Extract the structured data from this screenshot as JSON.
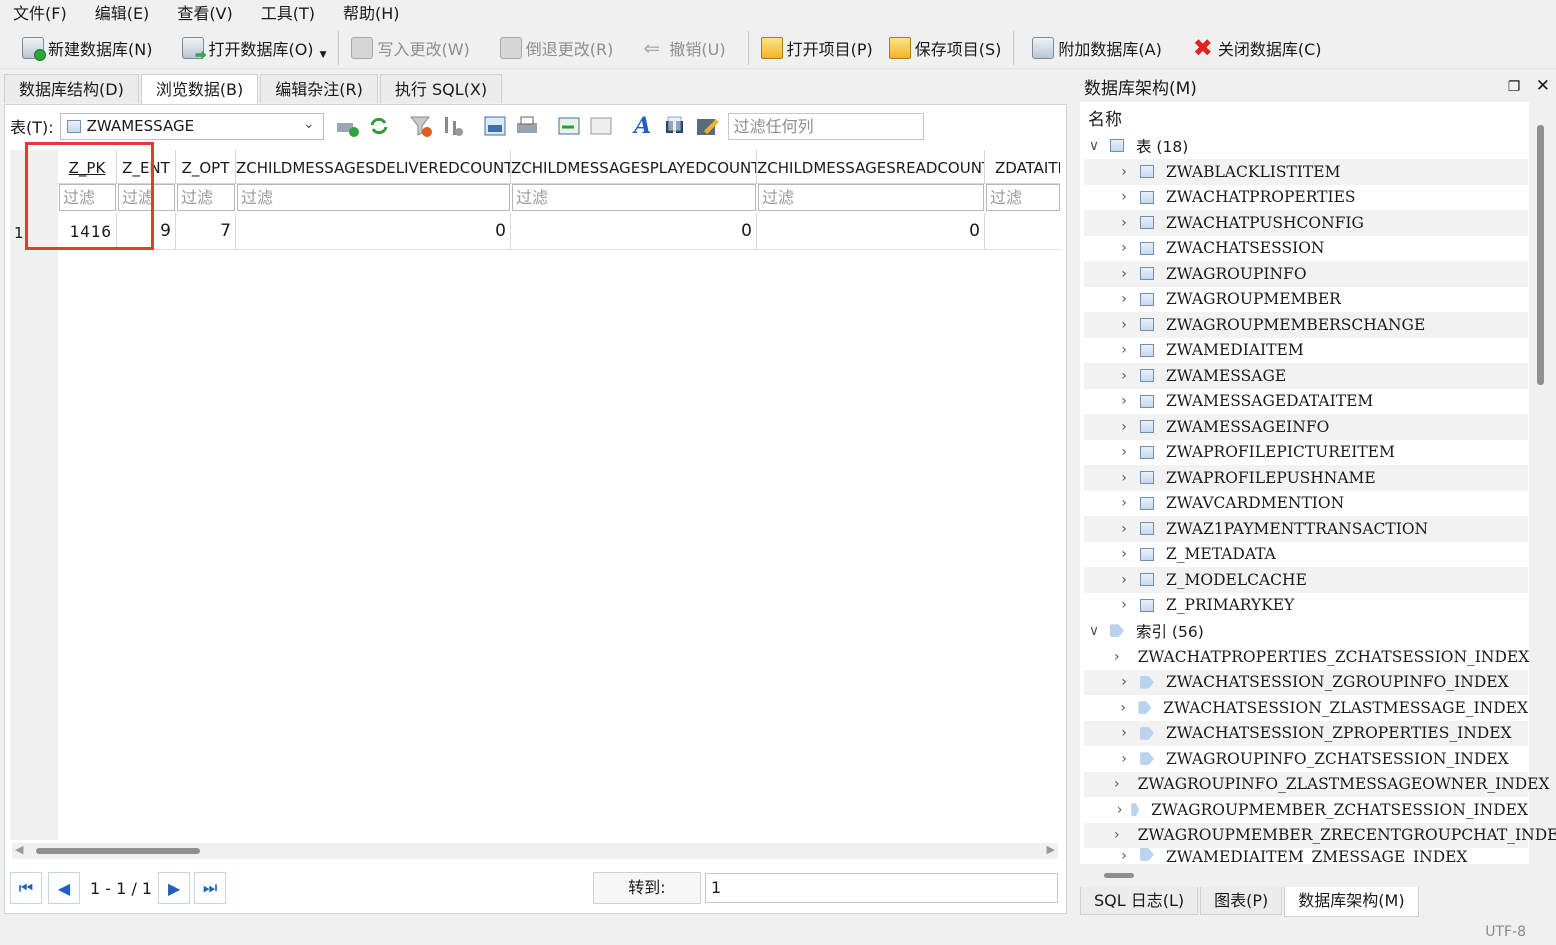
{
  "menu": [
    "文件(F)",
    "编辑(E)",
    "查看(V)",
    "工具(T)",
    "帮助(H)"
  ],
  "toolbar": {
    "new_db": "新建数据库(N)",
    "open_db": "打开数据库(O)",
    "write_changes": "写入更改(W)",
    "revert_changes": "倒退更改(R)",
    "undo": "撤销(U)",
    "open_project": "打开项目(P)",
    "save_project": "保存项目(S)",
    "attach_db": "附加数据库(A)",
    "close_db": "关闭数据库(C)"
  },
  "tabs": [
    "数据库结构(D)",
    "浏览数据(B)",
    "编辑杂注(R)",
    "执行 SQL(X)"
  ],
  "browse": {
    "table_label": "表(T):",
    "table_value": "ZWAMESSAGE",
    "filter_any_placeholder": "过滤任何列",
    "columns": [
      "Z_PK",
      "Z_ENT",
      "Z_OPT",
      "ZCHILDMESSAGESDELIVEREDCOUNT",
      "ZCHILDMESSAGESPLAYEDCOUNT",
      "ZCHILDMESSAGESREADCOUNT",
      "ZDATAITEM"
    ],
    "filter_placeholder": "过滤",
    "rows": [
      {
        "num": "1",
        "cells": [
          "1416",
          "9",
          "7",
          "0",
          "0",
          "0",
          ""
        ]
      }
    ]
  },
  "pagination": {
    "first": "1",
    "dash": "-",
    "current": "1",
    "slash": "/",
    "total": "1",
    "goto_label": "转到:",
    "goto_value": "1"
  },
  "schema_panel": {
    "title": "数据库架构(M)",
    "name_header": "名称",
    "tables_label": "表 (18)",
    "tables": [
      "ZWABLACKLISTITEM",
      "ZWACHATPROPERTIES",
      "ZWACHATPUSHCONFIG",
      "ZWACHATSESSION",
      "ZWAGROUPINFO",
      "ZWAGROUPMEMBER",
      "ZWAGROUPMEMBERSCHANGE",
      "ZWAMEDIAITEM",
      "ZWAMESSAGE",
      "ZWAMESSAGEDATAITEM",
      "ZWAMESSAGEINFO",
      "ZWAPROFILEPICTUREITEM",
      "ZWAPROFILEPUSHNAME",
      "ZWAVCARDMENTION",
      "ZWAZ1PAYMENTTRANSACTION",
      "Z_METADATA",
      "Z_MODELCACHE",
      "Z_PRIMARYKEY"
    ],
    "indexes_label": "索引 (56)",
    "indexes": [
      "ZWACHATPROPERTIES_ZCHATSESSION_INDEX",
      "ZWACHATSESSION_ZGROUPINFO_INDEX",
      "ZWACHATSESSION_ZLASTMESSAGE_INDEX",
      "ZWACHATSESSION_ZPROPERTIES_INDEX",
      "ZWAGROUPINFO_ZCHATSESSION_INDEX",
      "ZWAGROUPINFO_ZLASTMESSAGEOWNER_INDEX",
      "ZWAGROUPMEMBER_ZCHATSESSION_INDEX",
      "ZWAGROUPMEMBER_ZRECENTGROUPCHAT_INDEX",
      "ZWAMEDIAITEM_ZMESSAGE_INDEX"
    ]
  },
  "bottom_tabs": [
    "SQL 日志(L)",
    "图表(P)",
    "数据库架构(M)"
  ],
  "status": "UTF-8",
  "colors": {
    "highlight_box": "#e53935",
    "accent": "#1f5fbf"
  }
}
